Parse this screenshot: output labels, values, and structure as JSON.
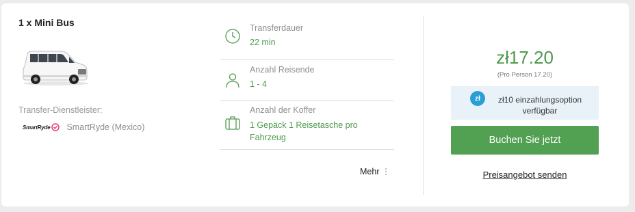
{
  "vehicle": {
    "title": "1 x Mini Bus",
    "image_icon": "white-minibus-van-image"
  },
  "provider": {
    "label": "Transfer-Dienstleister:",
    "logo_text": "SmartRyde",
    "logo_icon": "smartryde-check-logo",
    "name": "SmartRyde (Mexico)"
  },
  "details": [
    {
      "icon": "clock-icon",
      "label": "Transferdauer",
      "value": "22 min"
    },
    {
      "icon": "person-icon",
      "label": "Anzahl Reisende",
      "value": "1 - 4"
    },
    {
      "icon": "luggage-icon",
      "label": "Anzahl der Koffer",
      "value": "1 Gepäck 1 Reisetasche pro Fahrzeug"
    }
  ],
  "more": {
    "label": "Mehr",
    "icon": "more-vertical-icon"
  },
  "pricing": {
    "price": "zł17.20",
    "per_person": "(Pro Person 17.20)",
    "deposit_icon_text": "zł",
    "deposit_text": "zł10 einzahlungsoption verfügbar",
    "book_label": "Buchen Sie jetzt",
    "quote_label": "Preisangebot senden"
  },
  "colors": {
    "accent_green": "#52a052",
    "value_green": "#4e9a4e",
    "deposit_blue": "#2a9fd6",
    "deposit_bg": "#e8f2f8",
    "logo_pink": "#e8336d"
  }
}
